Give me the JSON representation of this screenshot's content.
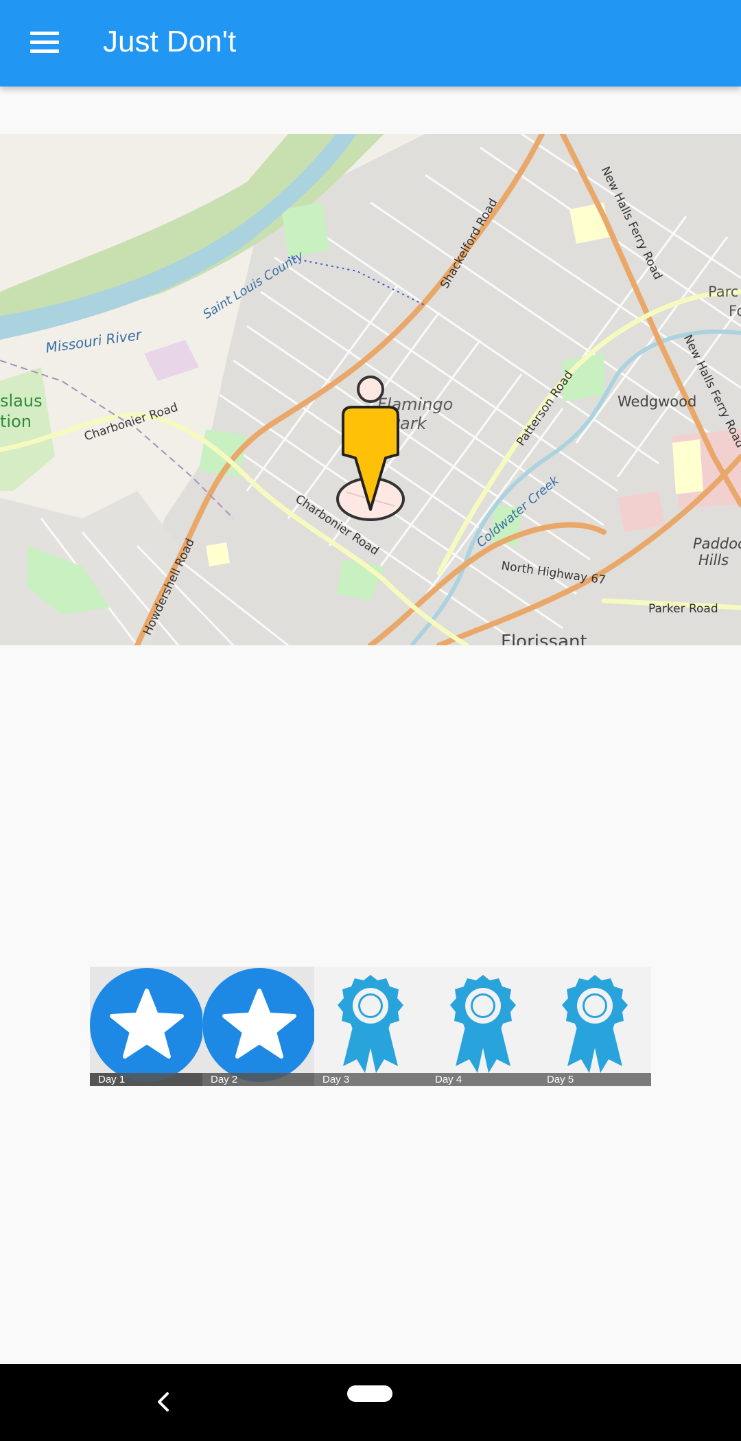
{
  "app": {
    "title": "Just Don't",
    "menu_icon": "hamburger-menu-icon",
    "accent_color": "#2196f3"
  },
  "map": {
    "labels": {
      "missouri_river": "Missouri River",
      "saint_louis_county": "Saint Louis County",
      "flamingo_park": "Flamingo Park",
      "charbonier_road_1": "Charbonier Road",
      "charbonier_road_2": "Charbonier Road",
      "shackelford_road": "Shackelford Road",
      "new_halls_ferry_road_1": "New Halls Ferry Road",
      "new_halls_ferry_road_2": "New Halls Ferry Road",
      "patterson_road": "Patterson Road",
      "coldwater_creek": "Coldwater Creek",
      "north_highway_67": "North Highway 67",
      "howdershell_road": "Howdershell Road",
      "parker_road": "Parker Road",
      "wedgwood": "Wedgwood",
      "paddock_hills": "Paddock Hills",
      "florissant": "Florissant",
      "stanislaus_partial": "slaus",
      "stanislaus_partial_2": "tion",
      "parc_partial": "Parc",
      "fo_partial": "Fo"
    },
    "marker_icon": "person-location-pin-icon",
    "marker_color": "#ffc107"
  },
  "progress": {
    "days": [
      {
        "label": "Day 1",
        "status": "completed",
        "icon": "star-badge-icon"
      },
      {
        "label": "Day 2",
        "status": "completed",
        "icon": "star-badge-icon"
      },
      {
        "label": "Day 3",
        "status": "pending",
        "icon": "award-ribbon-icon"
      },
      {
        "label": "Day 4",
        "status": "pending",
        "icon": "award-ribbon-icon"
      },
      {
        "label": "Day 5",
        "status": "pending",
        "icon": "award-ribbon-icon"
      }
    ],
    "completed_color": "#1e88e5",
    "pending_color": "#29a3dc"
  },
  "system_nav": {
    "back_icon": "back-chevron-icon",
    "home_icon": "home-pill-icon"
  }
}
